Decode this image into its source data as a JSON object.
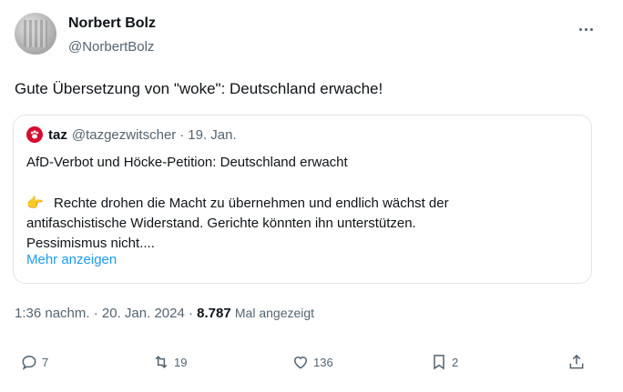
{
  "author": {
    "display_name": "Norbert Bolz",
    "handle": "@NorbertBolz"
  },
  "tweet": {
    "text": "Gute Übersetzung von \"woke\": Deutschland erwache!"
  },
  "quote": {
    "name": "taz",
    "handle": "@tazgezwitscher",
    "separator": "·",
    "date": "19. Jan.",
    "headline": "AfD-Verbot und Höcke-Petition: Deutschland erwacht",
    "emoji": "👉",
    "body_line1": "Rechte drohen die Macht zu übernehmen und endlich wächst der",
    "body_line2": "antifaschistische Widerstand. Gerichte könnten ihn unterstützen.",
    "body_line3": "Pessimismus nicht....",
    "show_more": "Mehr anzeigen",
    "logo_color": "#d50d2e"
  },
  "meta": {
    "time": "1:36 nachm.",
    "separator1": "·",
    "date": "20. Jan. 2024",
    "separator2": "·",
    "views": "8.787",
    "views_label": "Mal angezeigt"
  },
  "actions": {
    "replies": "7",
    "retweets": "19",
    "likes": "136",
    "bookmarks": "2"
  },
  "icons": {
    "reply": "reply-icon",
    "retweet": "retweet-icon",
    "like": "heart-icon",
    "bookmark": "bookmark-icon",
    "share": "share-icon",
    "more": "more-icon"
  },
  "colors": {
    "text": "#0f1419",
    "secondary": "#536471",
    "link": "#1d9bf0",
    "border": "#dfe4e8"
  }
}
